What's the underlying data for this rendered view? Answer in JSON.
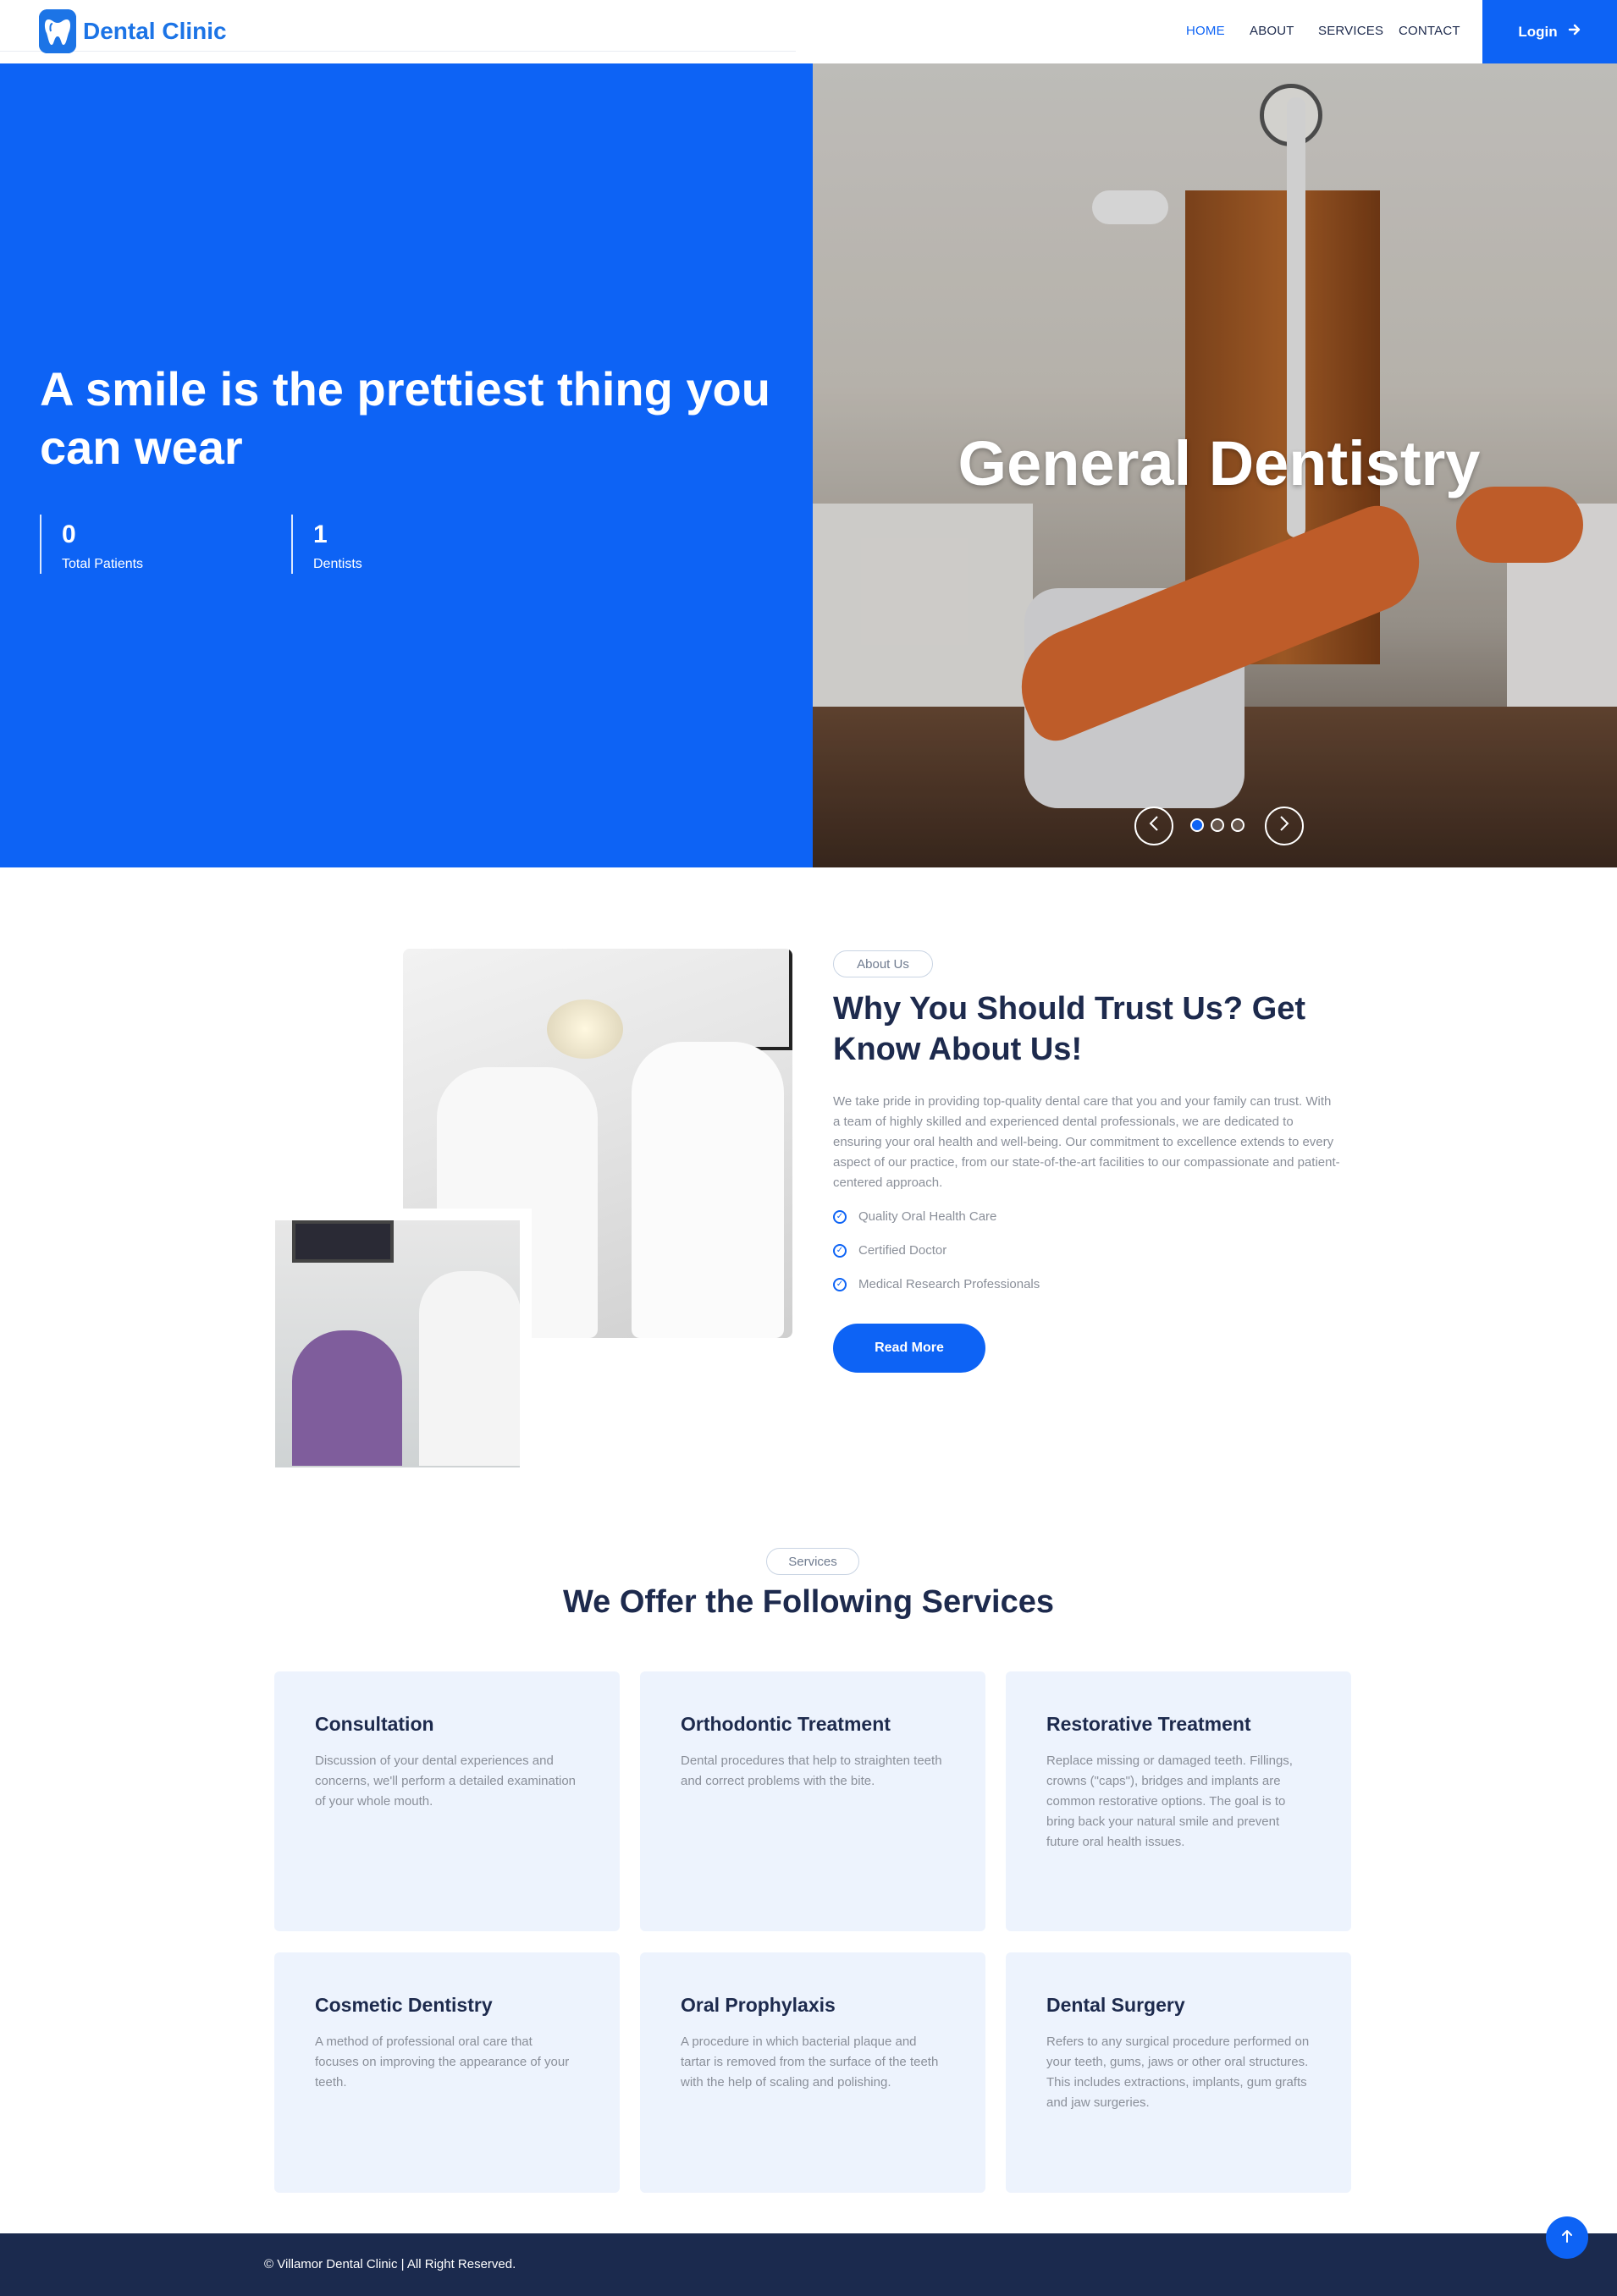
{
  "brand": {
    "name": "Dental Clinic",
    "accent": "#0d63f5"
  },
  "nav": {
    "items": [
      {
        "label": "HOME",
        "active": true
      },
      {
        "label": "ABOUT",
        "active": false
      },
      {
        "label": "SERVICES",
        "active": false
      },
      {
        "label": "CONTACT",
        "active": false
      }
    ],
    "login_label": "Login"
  },
  "hero": {
    "headline": "A smile is the prettiest thing you can wear",
    "stats": [
      {
        "value": "0",
        "label": "Total Patients"
      },
      {
        "value": "1",
        "label": "Dentists"
      }
    ],
    "slide_title": "General Dentistry",
    "slide_count": 3,
    "active_slide": 1
  },
  "about": {
    "tag": "About Us",
    "title": "Why You Should Trust Us? Get Know About Us!",
    "text": "We take pride in providing top-quality dental care that you and your family can trust. With a team of highly skilled and experienced dental professionals, we are dedicated to ensuring your oral health and well-being. Our commitment to excellence extends to every aspect of our practice, from our state-of-the-art facilities to our compassionate and patient-centered approach.",
    "checks": [
      "Quality Oral Health Care",
      "Certified Doctor",
      "Medical Research Professionals"
    ],
    "button": "Read More"
  },
  "services": {
    "tag": "Services",
    "title": "We Offer the Following Services",
    "items": [
      {
        "title": "Consultation",
        "text": "Discussion of your dental experiences and concerns, we'll perform a detailed examination of your whole mouth."
      },
      {
        "title": "Orthodontic Treatment",
        "text": "Dental procedures that help to straighten teeth and correct problems with the bite."
      },
      {
        "title": "Restorative Treatment",
        "text": "Replace missing or damaged teeth. Fillings, crowns (\"caps\"), bridges and implants are common restorative options. The goal is to bring back your natural smile and prevent future oral health issues."
      },
      {
        "title": "Cosmetic Dentistry",
        "text": "A method of professional oral care that focuses on improving the appearance of your teeth."
      },
      {
        "title": "Oral Prophylaxis",
        "text": "A procedure in which bacterial plaque and tartar is removed from the surface of the teeth with the help of scaling and polishing."
      },
      {
        "title": "Dental Surgery",
        "text": "Refers to any surgical procedure performed on your teeth, gums, jaws or other oral structures. This includes extractions, implants, gum grafts and jaw surgeries."
      }
    ]
  },
  "footer": {
    "copyright": "© Villamor Dental Clinic | All Right Reserved."
  },
  "icons": {
    "logo": "tooth-icon",
    "login": "arrow-right-icon",
    "prev": "chevron-left-icon",
    "next": "chevron-right-icon",
    "check": "check-circle-icon",
    "top": "arrow-up-icon"
  }
}
